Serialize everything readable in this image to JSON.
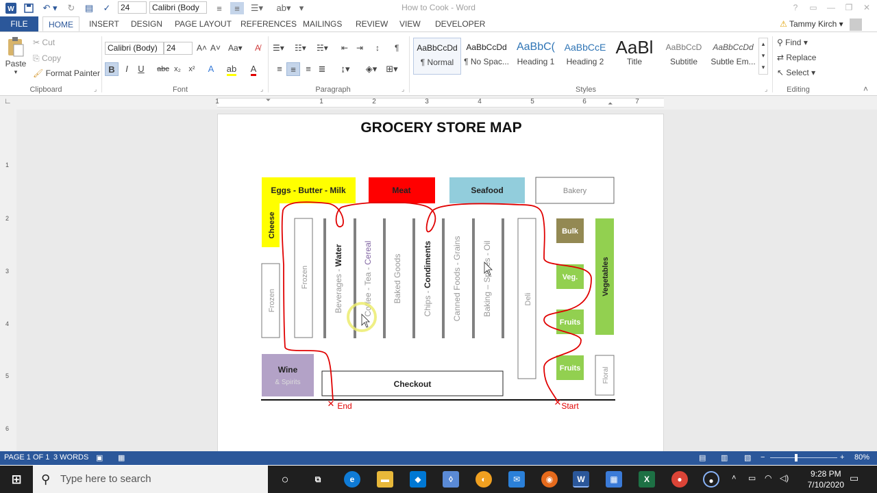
{
  "window": {
    "title": "How to Cook - Word",
    "font_size": "24",
    "font_name": "Calibri (Body"
  },
  "tabs": [
    "FILE",
    "HOME",
    "INSERT",
    "DESIGN",
    "PAGE LAYOUT",
    "REFERENCES",
    "MAILINGS",
    "REVIEW",
    "VIEW",
    "DEVELOPER"
  ],
  "user": "Tammy Kirch",
  "ribbon": {
    "clipboard": {
      "paste": "Paste",
      "cut": "Cut",
      "copy": "Copy",
      "format_painter": "Format Painter",
      "label": "Clipboard"
    },
    "font": {
      "name": "Calibri (Body)",
      "size": "24",
      "label": "Font"
    },
    "paragraph": {
      "label": "Paragraph"
    },
    "styles": {
      "label": "Styles",
      "items": [
        {
          "preview": "AaBbCcDd",
          "name": "¶ Normal"
        },
        {
          "preview": "AaBbCcDd",
          "name": "¶ No Spac..."
        },
        {
          "preview": "AaBbC(",
          "name": "Heading 1"
        },
        {
          "preview": "AaBbCcE",
          "name": "Heading 2"
        },
        {
          "preview": "AaBl",
          "name": "Title"
        },
        {
          "preview": "AaBbCcD",
          "name": "Subtitle"
        },
        {
          "preview": "AaBbCcDd",
          "name": "Subtle Em..."
        }
      ]
    },
    "editing": {
      "find": "Find",
      "replace": "Replace",
      "select": "Select",
      "label": "Editing"
    }
  },
  "ruler": {
    "numbers": [
      "1",
      "1",
      "2",
      "3",
      "4",
      "5",
      "6",
      "7"
    ]
  },
  "vruler": {
    "numbers": [
      "1",
      "2",
      "3",
      "4",
      "5",
      "6"
    ]
  },
  "document": {
    "title": "GROCERY STORE MAP",
    "map": {
      "departments": {
        "eggs": "Eggs - Butter - Milk",
        "meat": "Meat",
        "seafood": "Seafood",
        "bakery": "Bakery",
        "cheese": "Cheese",
        "bulk": "Bulk",
        "veg": "Veg.",
        "vegetables": "Vegetables",
        "fruits1": "Fruits",
        "fruits2": "Fruits",
        "floral": "Floral",
        "deli": "Deli",
        "wine": "Wine",
        "spirits": "& Spirits",
        "checkout": "Checkout",
        "frozen1": "Frozen",
        "frozen2": "Frozen"
      },
      "aisles": {
        "beverages": "Beverages - ",
        "water": "Water",
        "coffee_tea": "Coffee - Tea - ",
        "cereal": "Cereal",
        "baked": "Baked Goods",
        "chips": "Chips - ",
        "condiments": "Condiments",
        "canned": "Canned Foods - Grains",
        "baking": "Baking – Spices - Oil"
      },
      "end_label": "End",
      "start_label": "Start"
    }
  },
  "status": {
    "page": "PAGE 1 OF 1",
    "words": "3 WORDS",
    "zoom": "80%"
  },
  "taskbar": {
    "search_placeholder": "Type here to search",
    "time": "9:28 PM",
    "date": "7/10/2020"
  },
  "colors": {
    "word_blue": "#2b579a",
    "eggs": "#ffff00",
    "meat": "#ff0000",
    "seafood": "#92cddc",
    "bulk": "#938953",
    "green": "#92d050",
    "wine": "#b3a2c7",
    "route": "#e00000"
  }
}
